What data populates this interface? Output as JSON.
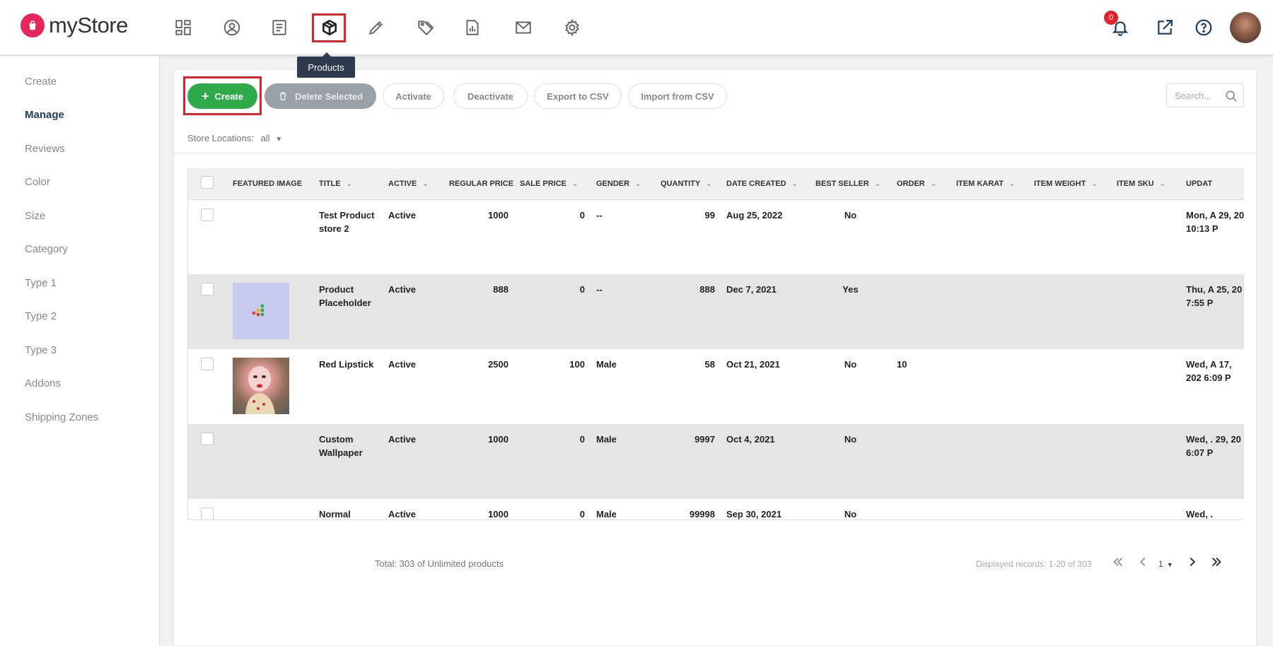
{
  "app": {
    "logo_text": "myStore",
    "brand_color": "#e5275c",
    "accent_green": "#2eaa4a"
  },
  "topnav": {
    "icons": [
      "dashboard-icon",
      "user-icon",
      "orders-icon",
      "products-icon",
      "edit-icon",
      "tag-icon",
      "reports-icon",
      "mail-icon",
      "settings-icon"
    ],
    "active": "products-icon",
    "tooltip": "Products",
    "notifications_count": "0"
  },
  "sidebar": {
    "items": [
      {
        "label": "Create",
        "active": false
      },
      {
        "label": "Manage",
        "active": true
      },
      {
        "label": "Reviews",
        "active": false
      },
      {
        "label": "Color",
        "active": false
      },
      {
        "label": "Size",
        "active": false
      },
      {
        "label": "Category",
        "active": false
      },
      {
        "label": "Type 1",
        "active": false
      },
      {
        "label": "Type 2",
        "active": false
      },
      {
        "label": "Type 3",
        "active": false
      },
      {
        "label": "Addons",
        "active": false
      },
      {
        "label": "Shipping Zones",
        "active": false
      }
    ]
  },
  "toolbar": {
    "create_label": "Create",
    "delete_label": "Delete Selected",
    "activate_label": "Activate",
    "deactivate_label": "Deactivate",
    "export_label": "Export to CSV",
    "import_label": "Import from CSV",
    "search_placeholder": "Search..."
  },
  "filter": {
    "label": "Store Locations:",
    "value": "all"
  },
  "table": {
    "columns": [
      "FEATURED IMAGE",
      "TITLE",
      "ACTIVE",
      "REGULAR PRICE",
      "SALE PRICE",
      "GENDER",
      "QUANTITY",
      "DATE CREATED",
      "BEST SELLER",
      "ORDER",
      "ITEM KARAT",
      "ITEM WEIGHT",
      "ITEM SKU",
      "UPDAT"
    ],
    "rows": [
      {
        "title": "Test Product store 2",
        "active": "Active",
        "regular_price": "1000",
        "sale_price": "0",
        "gender": "--",
        "quantity": "99",
        "date_created": "Aug 25, 2022",
        "best_seller": "No",
        "order": "",
        "updated": "Mon, A 29, 20 10:13 P",
        "image": "none"
      },
      {
        "title": "Product Placeholder",
        "active": "Active",
        "regular_price": "888",
        "sale_price": "0",
        "gender": "--",
        "quantity": "888",
        "date_created": "Dec 7, 2021",
        "best_seller": "Yes",
        "order": "",
        "updated": "Thu, A 25, 20 7:55 P",
        "image": "placeholder"
      },
      {
        "title": "Red Lipstick",
        "active": "Active",
        "regular_price": "2500",
        "sale_price": "100",
        "gender": "Male",
        "quantity": "58",
        "date_created": "Oct 21, 2021",
        "best_seller": "No",
        "order": "10",
        "updated": "Wed, A 17, 202 6:09 P",
        "image": "photo"
      },
      {
        "title": "Custom Wallpaper",
        "active": "Active",
        "regular_price": "1000",
        "sale_price": "0",
        "gender": "Male",
        "quantity": "9997",
        "date_created": "Oct 4, 2021",
        "best_seller": "No",
        "order": "",
        "updated": "Wed, . 29, 20 6:07 P",
        "image": "none"
      },
      {
        "title": "Normal",
        "active": "Active",
        "regular_price": "1000",
        "sale_price": "0",
        "gender": "Male",
        "quantity": "99998",
        "date_created": "Sep 30, 2021",
        "best_seller": "No",
        "order": "",
        "updated": "Wed, .",
        "image": "none"
      }
    ]
  },
  "footer": {
    "total": "Total: 303 of Unlimited products",
    "displayed": "Displayed records: 1-20 of 303",
    "page": "1"
  }
}
